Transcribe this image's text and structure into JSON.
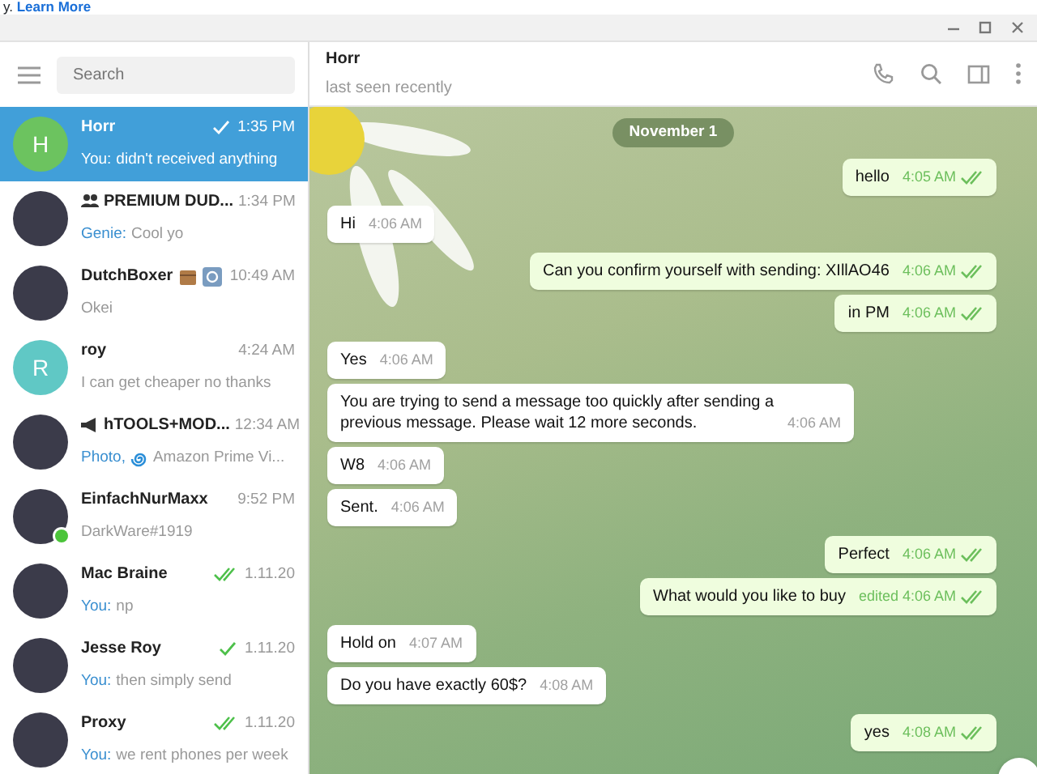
{
  "banner": {
    "text": "y.",
    "link": "Learn More"
  },
  "sidebar": {
    "search": {
      "placeholder": "Search"
    },
    "chats": [
      {
        "kind": "user",
        "name": "Horr",
        "avatar": {
          "kind": "letter",
          "letter": "H",
          "color": "#6cc35f"
        },
        "time": "1:35 PM",
        "read": false,
        "sender": "You:",
        "preview": "didn't received anything",
        "selected": true,
        "online": false
      },
      {
        "kind": "group",
        "name": "PREMIUM DUD...",
        "avatar": {
          "kind": "photo"
        },
        "time": "1:34 PM",
        "sender": "Genie:",
        "preview": "Cool yo",
        "selected": false,
        "online": false
      },
      {
        "kind": "user",
        "name": "DutchBoxer",
        "name_emoji": true,
        "avatar": {
          "kind": "photo"
        },
        "time": "10:49 AM",
        "preview": "Okei",
        "selected": false,
        "online": false
      },
      {
        "kind": "user",
        "name": "roy",
        "avatar": {
          "kind": "letter",
          "letter": "R",
          "color": "#60c8c5"
        },
        "time": "4:24 AM",
        "preview": "I can get cheaper no thanks",
        "selected": false,
        "online": false
      },
      {
        "kind": "channel",
        "name": "hTOOLS+MOD...",
        "avatar": {
          "kind": "photo"
        },
        "time": "12:34 AM",
        "sender": "Photo,",
        "preview_icon": true,
        "preview": "Amazon Prime Vi...",
        "selected": false,
        "online": false
      },
      {
        "kind": "user",
        "name": "EinfachNurMaxx",
        "avatar": {
          "kind": "photo"
        },
        "time": "9:52 PM",
        "preview": "DarkWare#1919",
        "selected": false,
        "online": true
      },
      {
        "kind": "user",
        "name": "Mac Braine",
        "avatar": {
          "kind": "photo"
        },
        "time": "1.11.20",
        "read": true,
        "sender": "You:",
        "preview": "np",
        "selected": false,
        "online": false
      },
      {
        "kind": "user",
        "name": "Jesse Roy",
        "avatar": {
          "kind": "photo"
        },
        "time": "1.11.20",
        "read": false,
        "sender": "You:",
        "preview": "then simply send",
        "selected": false,
        "online": false
      },
      {
        "kind": "user",
        "name": "Proxy",
        "avatar": {
          "kind": "photo"
        },
        "time": "1.11.20",
        "read": true,
        "sender": "You:",
        "preview": "we rent phones per week",
        "selected": false,
        "online": false
      }
    ]
  },
  "chat": {
    "title": "Horr",
    "status": "last seen recently",
    "date": "November 1",
    "messages": [
      {
        "kind": "out",
        "text": "hello",
        "time": "4:05 AM"
      },
      {
        "kind": "in",
        "text": "Hi",
        "time": "4:06 AM"
      },
      {
        "kind": "out",
        "text": "Can you confirm yourself with sending: XIllAO46",
        "time": "4:06 AM"
      },
      {
        "kind": "out",
        "text": "in PM",
        "time": "4:06 AM"
      },
      {
        "kind": "in",
        "text": "Yes",
        "time": "4:06 AM"
      },
      {
        "kind": "in",
        "text": "You are trying to send a message too quickly after sending a previous message. Please wait 12 more seconds.",
        "time": "4:06 AM"
      },
      {
        "kind": "in",
        "text": "W8",
        "time": "4:06 AM"
      },
      {
        "kind": "in",
        "text": "Sent.",
        "time": "4:06 AM"
      },
      {
        "kind": "out",
        "text": "Perfect",
        "time": "4:06 AM"
      },
      {
        "kind": "out",
        "text": "What would you like to buy",
        "time": "edited 4:06 AM"
      },
      {
        "kind": "in",
        "text": "Hold on",
        "time": "4:07 AM"
      },
      {
        "kind": "in",
        "text": "Do you have exactly 60$?",
        "time": "4:08 AM"
      },
      {
        "kind": "out",
        "text": "yes",
        "time": "4:08 AM"
      }
    ]
  }
}
